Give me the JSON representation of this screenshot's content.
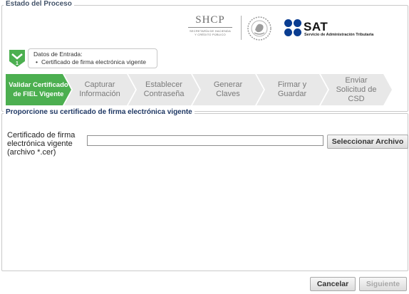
{
  "header": {
    "section_title": "Estado del Proceso",
    "shcp": {
      "name": "SHCP",
      "subtitle_line1": "SECRETARÍA DE HACIENDA",
      "subtitle_line2": "Y CRÉDITO PÚBLICO"
    },
    "sat": {
      "name": "SAT",
      "subtitle": "Servicio de Administración Tributaria"
    }
  },
  "current_step": {
    "number": "1",
    "title": "Datos de Entrada:",
    "item": "Certificado de firma electrónica vigente"
  },
  "steps": [
    {
      "label": "Validar Certificado\nde FIEL Vigente",
      "active": true
    },
    {
      "label": "Capturar\nInformación",
      "active": false
    },
    {
      "label": "Establecer\nContraseña",
      "active": false
    },
    {
      "label": "Generar\nClaves",
      "active": false
    },
    {
      "label": "Firmar y\nGuardar",
      "active": false
    },
    {
      "label": "Enviar\nSolicitud de\nCSD",
      "active": false
    }
  ],
  "certificate_section": {
    "title": "Proporcione su certificado de firma electrónica vigente",
    "field_label": "Certificado de firma\nelectrónica vigente\n(archivo *.cer)",
    "field_value": "",
    "select_button": "Seleccionar Archivo"
  },
  "footer": {
    "cancel_button": "Cancelar",
    "next_button": "Siguiente",
    "next_enabled": false
  },
  "colors": {
    "active_step": "#4caf50",
    "inactive_step": "#e8e8e8",
    "sat_blue": "#0a3d91"
  }
}
